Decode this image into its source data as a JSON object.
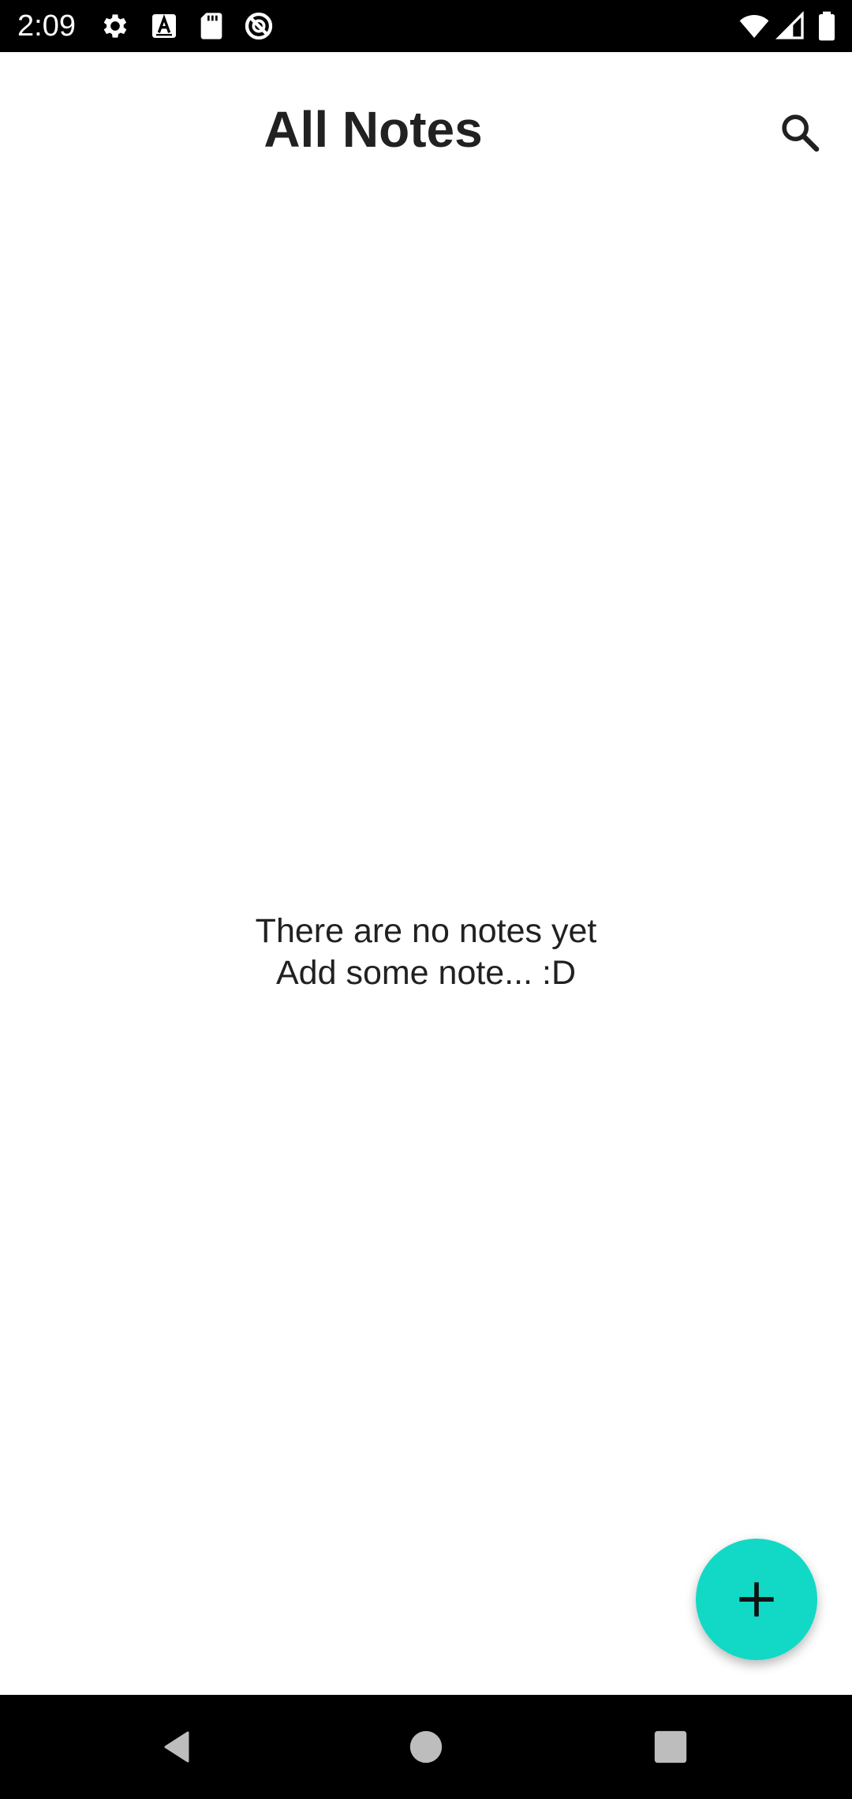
{
  "status_bar": {
    "time": "2:09",
    "left_icons": [
      "gear-icon",
      "font-a-icon",
      "sd-card-icon",
      "no-disturb-icon"
    ],
    "right_icons": [
      "wifi-icon",
      "cell-signal-icon",
      "battery-icon"
    ]
  },
  "header": {
    "title": "All Notes",
    "search_icon": "search-icon"
  },
  "empty_state": {
    "line1": "There are no notes yet",
    "line2": "Add some note... :D"
  },
  "fab": {
    "icon": "plus-icon",
    "color": "#12d9c5"
  },
  "nav_bar": {
    "buttons": [
      "back-icon",
      "home-icon",
      "recents-icon"
    ]
  },
  "colors": {
    "status_bar_bg": "#000000",
    "nav_bar_bg": "#000000",
    "title_text": "#212121",
    "accent": "#12d9c5"
  }
}
